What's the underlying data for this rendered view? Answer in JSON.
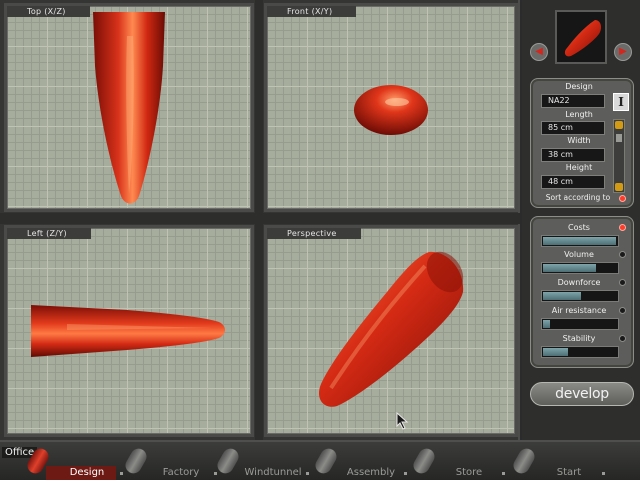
{
  "viewports": {
    "top": {
      "label": "Top (X/Z)"
    },
    "front": {
      "label": "Front (X/Y)"
    },
    "left": {
      "label": "Left (Z/Y)"
    },
    "perspective": {
      "label": "Perspective"
    }
  },
  "panel": {
    "design_label": "Design",
    "design_value": "NA22",
    "length_label": "Length",
    "length_value": "85 cm",
    "width_label": "Width",
    "width_value": "38 cm",
    "height_label": "Height",
    "height_value": "48 cm",
    "sort_label": "Sort according to",
    "info_button": "I",
    "metrics": [
      {
        "label": "Costs",
        "level": 0.98
      },
      {
        "label": "Volume",
        "level": 0.72
      },
      {
        "label": "Downforce",
        "level": 0.52
      },
      {
        "label": "Air resistance",
        "level": 0.1
      },
      {
        "label": "Stability",
        "level": 0.34
      }
    ],
    "develop_label": "develop"
  },
  "bottombar": {
    "office_label": "Office",
    "tabs": [
      "Design",
      "Factory",
      "Windtunnel",
      "Assembly",
      "Store",
      "Start"
    ],
    "active_tab": "Design"
  },
  "colors": {
    "accent_red": "#d4261d",
    "grid_bg": "#a7ad9d",
    "bar_fill": "#6f949a"
  }
}
